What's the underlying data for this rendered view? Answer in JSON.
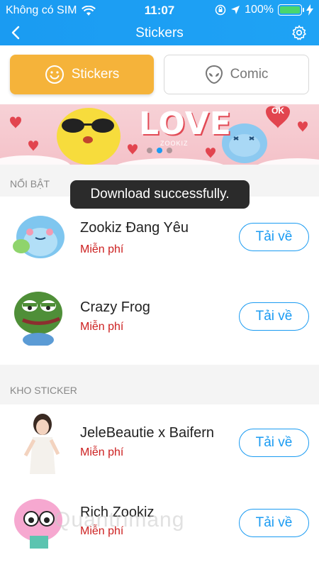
{
  "status": {
    "carrier": "Không có SIM",
    "time": "11:07",
    "battery": "100%",
    "battery_level": 1.0
  },
  "nav": {
    "title": "Stickers"
  },
  "tabs": [
    {
      "label": "Stickers",
      "active": true
    },
    {
      "label": "Comic",
      "active": false
    }
  ],
  "banner": {
    "text": "LOVE",
    "sub": "ZOOKIZ",
    "badge": "OK",
    "dots": 3,
    "active_dot": 1
  },
  "toast": {
    "text": "Download successfully."
  },
  "sections": {
    "featured": {
      "title": "NỔI BẬT"
    },
    "store": {
      "title": "KHO STICKER"
    }
  },
  "featured_items": [
    {
      "name": "Zookiz Đang Yêu",
      "price": "Miễn phí",
      "button": "Tải về"
    },
    {
      "name": "Crazy Frog",
      "price": "Miễn phí",
      "button": "Tải về"
    }
  ],
  "store_items": [
    {
      "name": "JeleBeautie x Baifern",
      "price": "Miễn phí",
      "button": "Tải về"
    },
    {
      "name": "Rich Zookiz",
      "price": "Miễn phí",
      "button": "Tải về"
    }
  ],
  "watermark": "Quantrimang",
  "colors": {
    "header_blue": "#1a9bf2",
    "tab_active": "#f5b33a",
    "price_red": "#cc1f1f",
    "battery_green": "#49d66d"
  }
}
